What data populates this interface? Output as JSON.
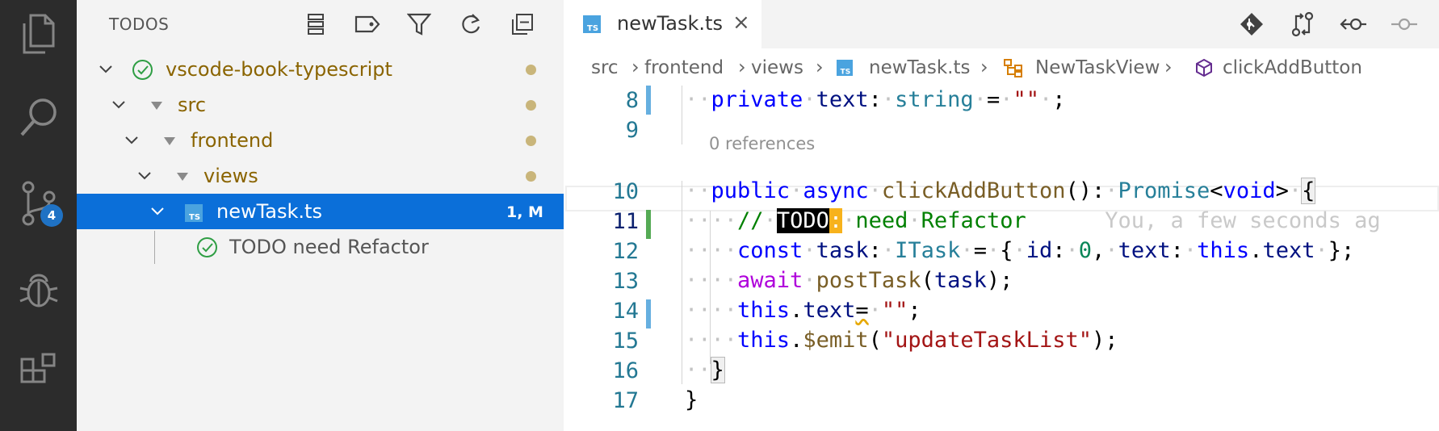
{
  "activity_bar": {
    "items": [
      {
        "icon": "files-icon"
      },
      {
        "icon": "search-icon"
      },
      {
        "icon": "source-control-icon",
        "badge": "4"
      },
      {
        "icon": "debug-icon"
      },
      {
        "icon": "extensions-icon"
      }
    ]
  },
  "sidebar": {
    "title": "TODOS",
    "actions": [
      "list-icon",
      "tag-icon",
      "filter-icon",
      "refresh-icon",
      "collapse-all-icon"
    ],
    "tree": [
      {
        "label": "vscode-book-typescript",
        "color": "#8a6400"
      },
      {
        "label": "src",
        "color": "#8a6400"
      },
      {
        "label": "frontend",
        "color": "#8a6400"
      },
      {
        "label": "views",
        "color": "#8a6400"
      },
      {
        "label": "newTask.ts",
        "meta": "1, M",
        "color": "#ffffff"
      },
      {
        "label": "TODO need Refactor",
        "color": "#555555"
      }
    ]
  },
  "editor": {
    "tab": {
      "label": "newTask.ts",
      "close": "×"
    },
    "actions": [
      "git-commit-icon",
      "compare-changes-icon",
      "go-back-icon",
      "go-forward-icon"
    ],
    "breadcrumb": [
      "src",
      "frontend",
      "views",
      "newTask.ts",
      "NewTaskView",
      "clickAddButton"
    ],
    "codelens": "0 references",
    "line_numbers": [
      "8",
      "9",
      "10",
      "11",
      "12",
      "13",
      "14",
      "15",
      "16",
      "17"
    ],
    "blame": "You, a few seconds ag"
  },
  "colors": {
    "accent": "#0b6fd9",
    "activity_bg": "#2c2c2c",
    "todo_highlight": "#f7b21c"
  }
}
